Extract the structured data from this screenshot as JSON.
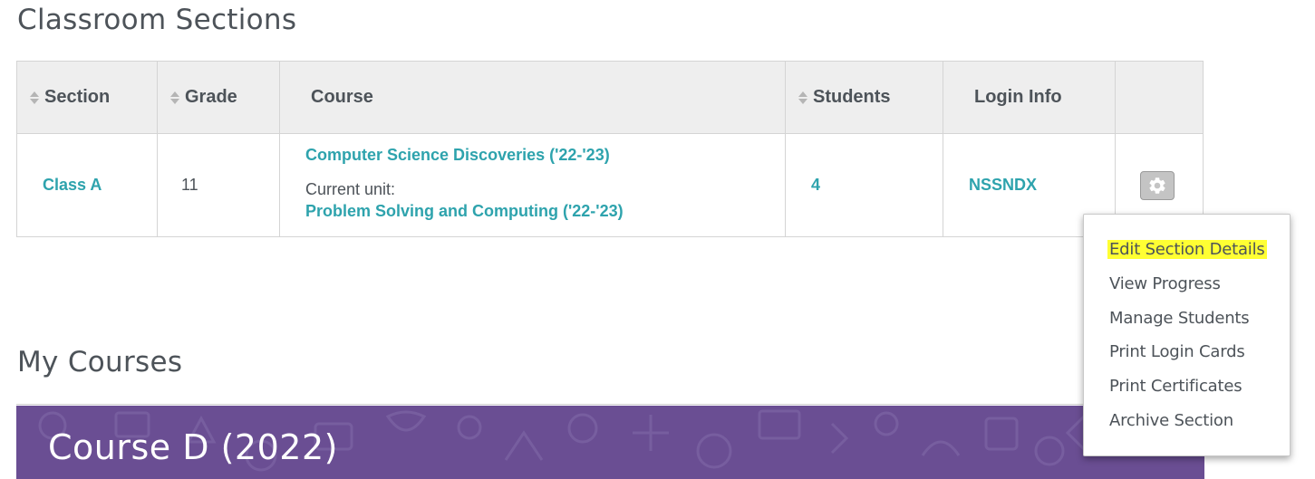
{
  "sections_title": "Classroom Sections",
  "table": {
    "headers": {
      "section": "Section",
      "grade": "Grade",
      "course": "Course",
      "students": "Students",
      "login_info": "Login Info"
    },
    "row": {
      "section": "Class A",
      "grade": "11",
      "course": "Computer Science Discoveries ('22-'23)",
      "current_unit_label": "Current unit:",
      "current_unit": "Problem Solving and Computing ('22-'23)",
      "students": "4",
      "login_info": "NSSNDX"
    }
  },
  "menu": {
    "items": [
      "Edit Section Details",
      "View Progress",
      "Manage Students",
      "Print Login Cards",
      "Print Certificates",
      "Archive Section"
    ],
    "highlighted_item": "Edit Section Details",
    "highlight_color": "#ffff33"
  },
  "courses_title": "My Courses",
  "course_card": {
    "title": "Course D (2022)",
    "color": "#6a4e93"
  },
  "colors": {
    "link": "#2ea3ad",
    "text": "#4d5359",
    "header_bg": "#eeeeee"
  }
}
